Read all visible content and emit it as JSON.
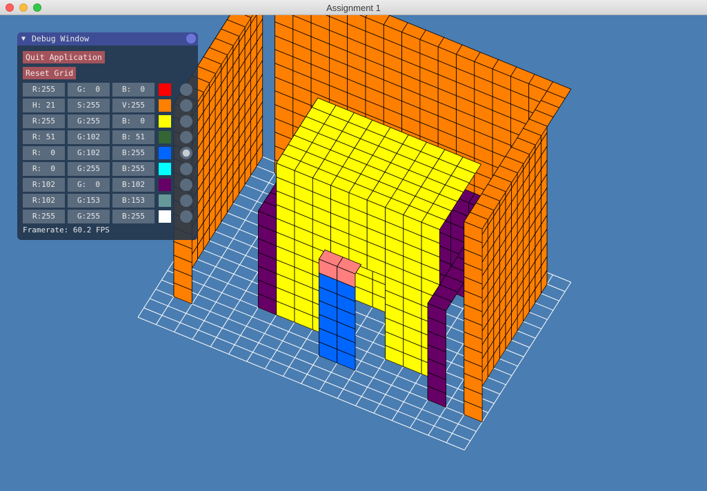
{
  "window": {
    "title": "Assignment 1"
  },
  "debug": {
    "title": "Debug Window",
    "quit_label": "Quit Application",
    "reset_label": "Reset Grid",
    "rows": [
      {
        "a": "R:255",
        "b": "G:  0",
        "c": "B:  0",
        "color": "#ff0000"
      },
      {
        "a": "H: 21",
        "b": "S:255",
        "c": "V:255",
        "color": "#ff7f00"
      },
      {
        "a": "R:255",
        "b": "G:255",
        "c": "B:  0",
        "color": "#ffff00"
      },
      {
        "a": "R: 51",
        "b": "G:102",
        "c": "B: 51",
        "color": "#336633"
      },
      {
        "a": "R:  0",
        "b": "G:102",
        "c": "B:255",
        "color": "#0066ff"
      },
      {
        "a": "R:  0",
        "b": "G:255",
        "c": "B:255",
        "color": "#00ffff"
      },
      {
        "a": "R:102",
        "b": "G:  0",
        "c": "B:102",
        "color": "#660066"
      },
      {
        "a": "R:102",
        "b": "G:153",
        "c": "B:153",
        "color": "#669999"
      },
      {
        "a": "R:255",
        "b": "G:255",
        "c": "B:255",
        "color": "#ffffff"
      }
    ],
    "selected_row": 4,
    "framerate": "Framerate: 60.2 FPS"
  },
  "scene": {
    "background": "#4a7db1",
    "grid_color": "#ffffff",
    "colors": {
      "orange": "#ff7f00",
      "purple": "#660066",
      "yellow": "#ffff00",
      "blue": "#0066ff",
      "salmon": "#ff7f7f"
    }
  }
}
